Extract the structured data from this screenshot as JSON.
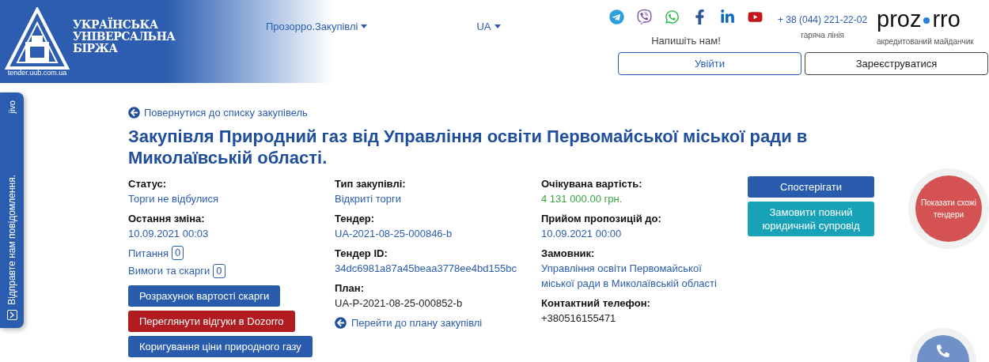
{
  "header": {
    "logo": {
      "name_lines": [
        "УКРАЇНСЬКА",
        "УНІВЕРСАЛЬНА",
        "БІРЖА"
      ],
      "site": "tender.uub.com.ua"
    },
    "nav": [
      {
        "label": "Прозорро.Закупівлі"
      },
      {
        "label": "UA"
      }
    ],
    "write_us": "Напишіть нам!",
    "phone": "+ 38 (044) 221-22-02",
    "phone_caption": "гаряча лінія",
    "brand": {
      "left": "proz",
      "right": "rro",
      "caption": "акредитований майданчик"
    },
    "buttons": [
      {
        "label": "Увійти",
        "kind": "primary"
      },
      {
        "label": "Зареєструватися",
        "kind": "secondary"
      }
    ]
  },
  "back_link": "Повернутися до списку закупівель",
  "title": "Закупівля Природний газ від Управління освіти Первомайської міської ради в Миколаївській області.",
  "columns": [
    {
      "items": [
        {
          "kind": "field",
          "label": "Статус:",
          "value": "Торги не відбулися",
          "color": "#2a5db0"
        },
        {
          "kind": "field",
          "label": "Остання зміна:",
          "value": "10.09.2021 00:03",
          "color": "#2a5db0"
        },
        {
          "kind": "counter",
          "label": "Питання",
          "count": "0"
        },
        {
          "kind": "counter",
          "label": "Вимоги та скарги",
          "count": "0"
        },
        {
          "kind": "button",
          "label": "Розрахунок вартості скарги",
          "color": "#2a5cae"
        },
        {
          "kind": "button",
          "label": "Переглянути відгуки в Dozorro",
          "color": "#b01c1f"
        },
        {
          "kind": "button",
          "label": "Коригування ціни природного газу",
          "color": "#2a5cae"
        }
      ]
    },
    {
      "items": [
        {
          "kind": "field",
          "label": "Тип закупівлі:",
          "value": "Відкриті торги",
          "color": "#2a5db0"
        },
        {
          "kind": "field",
          "label": "Тендер:",
          "value": "UA-2021-08-25-000846-b",
          "color": "#2a5db0"
        },
        {
          "kind": "field",
          "label": "Тендер ID:",
          "value": "34dc6981a87a45beaa3778ee4bd155bc",
          "color": "#2a5db0"
        },
        {
          "kind": "field",
          "label": "План:",
          "value": "UA-P-2021-08-25-000852-b",
          "color": "#222222"
        },
        {
          "kind": "link",
          "label": "Перейти до плану закупівлі"
        }
      ]
    },
    {
      "items": [
        {
          "kind": "field",
          "label": "Очікувана вартість:",
          "value": "4 131 000.00 грн.",
          "color": "#3aa346"
        },
        {
          "kind": "field",
          "label": "Прийом пропозицій до:",
          "value": "10.09.2021 00:00",
          "color": "#2a5db0"
        },
        {
          "kind": "field",
          "label": "Замовник:",
          "value": "Управління освіти Первомайської міської ради в Миколаївській області",
          "color": "#2a5db0"
        },
        {
          "kind": "field",
          "label": "Контактний телефон:",
          "value": "+380516155471",
          "color": "#222222"
        }
      ]
    },
    {
      "items": [
        {
          "kind": "button",
          "label": "Спостерігати",
          "color": "#2a5cae"
        },
        {
          "kind": "button",
          "label": "Замовити повний юридичний супровід",
          "color": "#17a2b8"
        }
      ]
    }
  ],
  "similar_button": "Показати схожі тендери",
  "chat_tab": {
    "brand": "jivo",
    "label": "Відправте нам повідомлення."
  }
}
